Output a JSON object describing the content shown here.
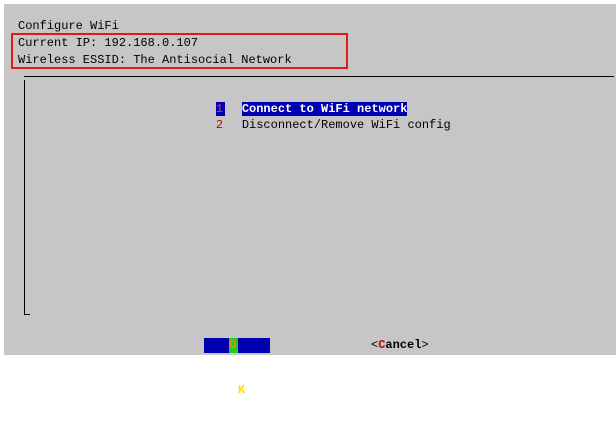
{
  "dialog": {
    "title": "Configure WiFi",
    "current_ip": "Current IP: 192.168.0.107",
    "essid": "Wireless ESSID: The Antisocial Network"
  },
  "menu": {
    "items": [
      {
        "number": "1",
        "label": "Connect to WiFi network",
        "selected": true
      },
      {
        "number": "2",
        "label": "Disconnect/Remove WiFi config",
        "selected": false
      }
    ]
  },
  "buttons": {
    "ok": {
      "open": "<",
      "hotkey": "O",
      "rest": "K",
      "close": ">",
      "focused": true
    },
    "cancel": {
      "open": "<",
      "hotkey": "C",
      "rest": "ancel",
      "close": ">"
    }
  },
  "colors": {
    "dialog_bg": "#c6c6c6",
    "highlight_bg": "#0000b0",
    "annotation_red": "#e11919",
    "hotkey_red": "#c00000"
  }
}
